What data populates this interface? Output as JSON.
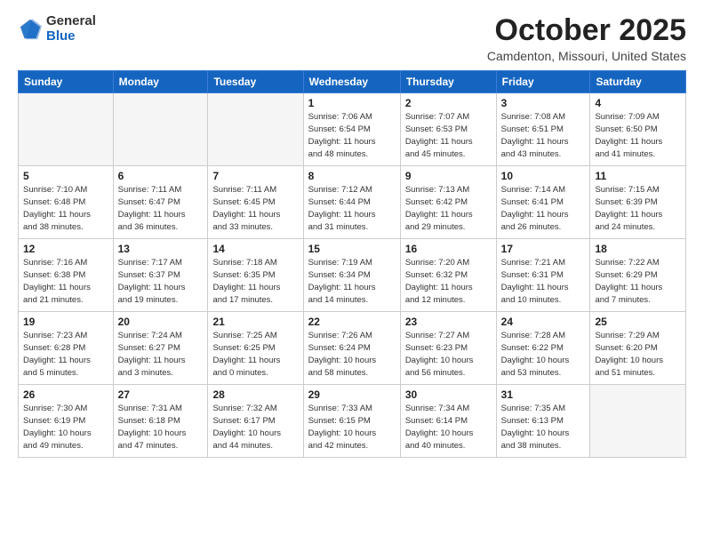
{
  "header": {
    "logo_general": "General",
    "logo_blue": "Blue",
    "month_title": "October 2025",
    "location": "Camdenton, Missouri, United States"
  },
  "days_of_week": [
    "Sunday",
    "Monday",
    "Tuesday",
    "Wednesday",
    "Thursday",
    "Friday",
    "Saturday"
  ],
  "weeks": [
    [
      {
        "day": "",
        "info": ""
      },
      {
        "day": "",
        "info": ""
      },
      {
        "day": "",
        "info": ""
      },
      {
        "day": "1",
        "info": "Sunrise: 7:06 AM\nSunset: 6:54 PM\nDaylight: 11 hours\nand 48 minutes."
      },
      {
        "day": "2",
        "info": "Sunrise: 7:07 AM\nSunset: 6:53 PM\nDaylight: 11 hours\nand 45 minutes."
      },
      {
        "day": "3",
        "info": "Sunrise: 7:08 AM\nSunset: 6:51 PM\nDaylight: 11 hours\nand 43 minutes."
      },
      {
        "day": "4",
        "info": "Sunrise: 7:09 AM\nSunset: 6:50 PM\nDaylight: 11 hours\nand 41 minutes."
      }
    ],
    [
      {
        "day": "5",
        "info": "Sunrise: 7:10 AM\nSunset: 6:48 PM\nDaylight: 11 hours\nand 38 minutes."
      },
      {
        "day": "6",
        "info": "Sunrise: 7:11 AM\nSunset: 6:47 PM\nDaylight: 11 hours\nand 36 minutes."
      },
      {
        "day": "7",
        "info": "Sunrise: 7:11 AM\nSunset: 6:45 PM\nDaylight: 11 hours\nand 33 minutes."
      },
      {
        "day": "8",
        "info": "Sunrise: 7:12 AM\nSunset: 6:44 PM\nDaylight: 11 hours\nand 31 minutes."
      },
      {
        "day": "9",
        "info": "Sunrise: 7:13 AM\nSunset: 6:42 PM\nDaylight: 11 hours\nand 29 minutes."
      },
      {
        "day": "10",
        "info": "Sunrise: 7:14 AM\nSunset: 6:41 PM\nDaylight: 11 hours\nand 26 minutes."
      },
      {
        "day": "11",
        "info": "Sunrise: 7:15 AM\nSunset: 6:39 PM\nDaylight: 11 hours\nand 24 minutes."
      }
    ],
    [
      {
        "day": "12",
        "info": "Sunrise: 7:16 AM\nSunset: 6:38 PM\nDaylight: 11 hours\nand 21 minutes."
      },
      {
        "day": "13",
        "info": "Sunrise: 7:17 AM\nSunset: 6:37 PM\nDaylight: 11 hours\nand 19 minutes."
      },
      {
        "day": "14",
        "info": "Sunrise: 7:18 AM\nSunset: 6:35 PM\nDaylight: 11 hours\nand 17 minutes."
      },
      {
        "day": "15",
        "info": "Sunrise: 7:19 AM\nSunset: 6:34 PM\nDaylight: 11 hours\nand 14 minutes."
      },
      {
        "day": "16",
        "info": "Sunrise: 7:20 AM\nSunset: 6:32 PM\nDaylight: 11 hours\nand 12 minutes."
      },
      {
        "day": "17",
        "info": "Sunrise: 7:21 AM\nSunset: 6:31 PM\nDaylight: 11 hours\nand 10 minutes."
      },
      {
        "day": "18",
        "info": "Sunrise: 7:22 AM\nSunset: 6:29 PM\nDaylight: 11 hours\nand 7 minutes."
      }
    ],
    [
      {
        "day": "19",
        "info": "Sunrise: 7:23 AM\nSunset: 6:28 PM\nDaylight: 11 hours\nand 5 minutes."
      },
      {
        "day": "20",
        "info": "Sunrise: 7:24 AM\nSunset: 6:27 PM\nDaylight: 11 hours\nand 3 minutes."
      },
      {
        "day": "21",
        "info": "Sunrise: 7:25 AM\nSunset: 6:25 PM\nDaylight: 11 hours\nand 0 minutes."
      },
      {
        "day": "22",
        "info": "Sunrise: 7:26 AM\nSunset: 6:24 PM\nDaylight: 10 hours\nand 58 minutes."
      },
      {
        "day": "23",
        "info": "Sunrise: 7:27 AM\nSunset: 6:23 PM\nDaylight: 10 hours\nand 56 minutes."
      },
      {
        "day": "24",
        "info": "Sunrise: 7:28 AM\nSunset: 6:22 PM\nDaylight: 10 hours\nand 53 minutes."
      },
      {
        "day": "25",
        "info": "Sunrise: 7:29 AM\nSunset: 6:20 PM\nDaylight: 10 hours\nand 51 minutes."
      }
    ],
    [
      {
        "day": "26",
        "info": "Sunrise: 7:30 AM\nSunset: 6:19 PM\nDaylight: 10 hours\nand 49 minutes."
      },
      {
        "day": "27",
        "info": "Sunrise: 7:31 AM\nSunset: 6:18 PM\nDaylight: 10 hours\nand 47 minutes."
      },
      {
        "day": "28",
        "info": "Sunrise: 7:32 AM\nSunset: 6:17 PM\nDaylight: 10 hours\nand 44 minutes."
      },
      {
        "day": "29",
        "info": "Sunrise: 7:33 AM\nSunset: 6:15 PM\nDaylight: 10 hours\nand 42 minutes."
      },
      {
        "day": "30",
        "info": "Sunrise: 7:34 AM\nSunset: 6:14 PM\nDaylight: 10 hours\nand 40 minutes."
      },
      {
        "day": "31",
        "info": "Sunrise: 7:35 AM\nSunset: 6:13 PM\nDaylight: 10 hours\nand 38 minutes."
      },
      {
        "day": "",
        "info": ""
      }
    ]
  ]
}
